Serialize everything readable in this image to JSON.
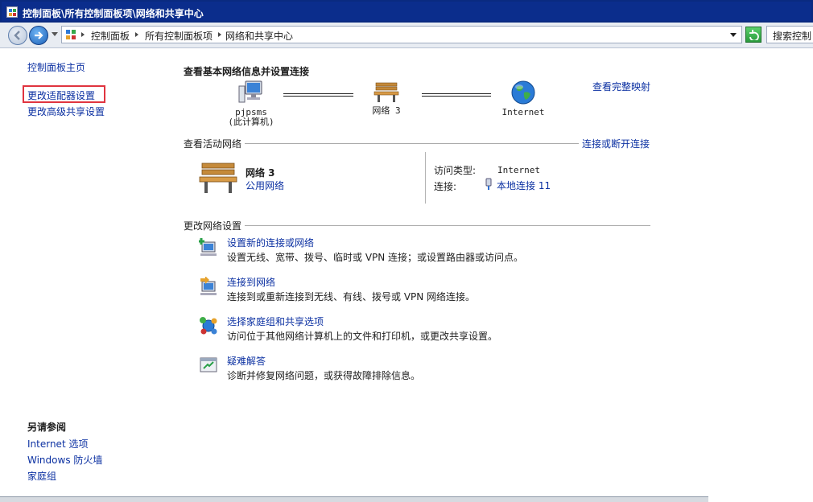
{
  "window": {
    "title": "控制面板\\所有控制面板项\\网络和共享中心"
  },
  "address": {
    "crumbs": [
      "控制面板",
      "所有控制面板项",
      "网络和共享中心"
    ],
    "search_placeholder": "搜索控制"
  },
  "left_nav": {
    "home": "控制面板主页",
    "items": [
      "更改适配器设置",
      "更改高级共享设置"
    ],
    "see_also_title": "另请参阅",
    "see_also": [
      "Internet 选项",
      "Windows 防火墙",
      "家庭组"
    ]
  },
  "main": {
    "heading": "查看基本网络信息并设置连接",
    "full_map_link": "查看完整映射",
    "map": {
      "computer_name": "pjpsms",
      "computer_caption": "(此计算机)",
      "network_label": "网络  3",
      "internet_label": "Internet"
    },
    "active_section": {
      "title": "查看活动网络",
      "link": "连接或断开连接",
      "network_name": "网络  3",
      "network_type": "公用网络",
      "access_type_label": "访问类型:",
      "access_type_value": "Internet",
      "connections_label": "连接:",
      "connections_value": "本地连接 11"
    },
    "change_section": {
      "title": "更改网络设置",
      "tasks": [
        {
          "title": "设置新的连接或网络",
          "desc": "设置无线、宽带、拨号、临时或 VPN 连接；或设置路由器或访问点。",
          "icon": "new-connection-icon"
        },
        {
          "title": "连接到网络",
          "desc": "连接到或重新连接到无线、有线、拨号或 VPN 网络连接。",
          "icon": "connect-network-icon"
        },
        {
          "title": "选择家庭组和共享选项",
          "desc": "访问位于其他网络计算机上的文件和打印机，或更改共享设置。",
          "icon": "homegroup-icon"
        },
        {
          "title": "疑难解答",
          "desc": "诊断并修复网络问题，或获得故障排除信息。",
          "icon": "troubleshoot-icon"
        }
      ]
    }
  }
}
